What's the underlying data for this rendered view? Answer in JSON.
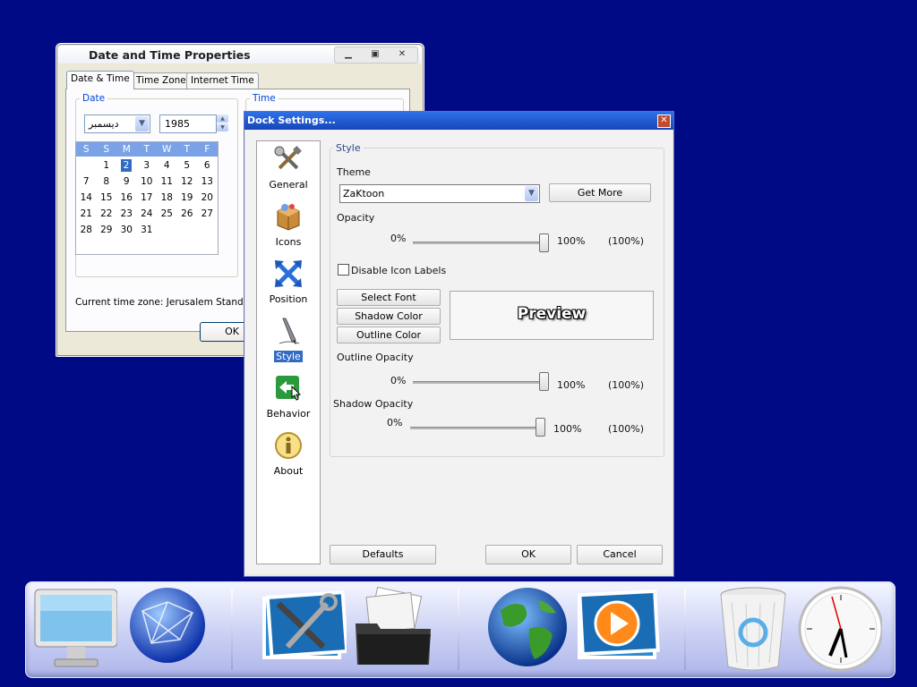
{
  "date_time_window": {
    "title": "Date and Time Properties",
    "controls": {
      "minimize": "▁",
      "maximize": "▣",
      "close": "✕"
    },
    "tabs": [
      "Date & Time",
      "Time Zone",
      "Internet Time"
    ],
    "date_group_label": "Date",
    "time_group_label": "Time",
    "month_value": "دیسمبر",
    "year_value": "1985",
    "calendar": {
      "day_headers": [
        "S",
        "S",
        "M",
        "T",
        "W",
        "T",
        "F"
      ],
      "weeks": [
        [
          "",
          "",
          "1",
          "2",
          "3",
          "4",
          "5",
          "6"
        ],
        [
          "7",
          "8",
          "9",
          "10",
          "11",
          "12",
          "13"
        ],
        [
          "14",
          "15",
          "16",
          "17",
          "18",
          "19",
          "20"
        ],
        [
          "21",
          "22",
          "23",
          "24",
          "25",
          "26",
          "27"
        ],
        [
          "28",
          "29",
          "30",
          "31",
          "",
          "",
          ""
        ]
      ],
      "selected_day": "2"
    },
    "timezone_text": "Current time zone:  Jerusalem Standard",
    "ok_label": "OK"
  },
  "dock_settings": {
    "title": "Dock Settings...",
    "close_glyph": "✕",
    "sidebar": [
      {
        "label": "General",
        "icon": "tools-icon"
      },
      {
        "label": "Icons",
        "icon": "box-icon"
      },
      {
        "label": "Position",
        "icon": "arrows-icon"
      },
      {
        "label": "Style",
        "icon": "pen-icon",
        "selected": true
      },
      {
        "label": "Behavior",
        "icon": "behavior-icon"
      },
      {
        "label": "About",
        "icon": "info-icon"
      }
    ],
    "style_group_label": "Style",
    "theme_label": "Theme",
    "theme_value": "ZaKtoon",
    "get_more_label": "Get More",
    "opacity_label": "Opacity",
    "opacity_min": "0%",
    "opacity_max": "100%",
    "opacity_value": "(100%)",
    "disable_labels_text": "Disable Icon Labels",
    "disable_labels_checked": false,
    "select_font_label": "Select Font",
    "shadow_color_label": "Shadow Color",
    "outline_color_label": "Outline Color",
    "preview_text": "Preview",
    "outline_opacity_label": "Outline Opacity",
    "outline_min": "0%",
    "outline_max": "100%",
    "outline_value": "(100%)",
    "shadow_opacity_label": "Shadow Opacity",
    "shadow_min": "0%",
    "shadow_max": "100%",
    "shadow_value": "(100%)",
    "defaults_label": "Defaults",
    "ok_label": "OK",
    "cancel_label": "Cancel"
  },
  "dock": {
    "items": [
      "monitor-icon",
      "network-globe-icon",
      "tools-icon",
      "folder-icon",
      "earth-icon",
      "media-player-icon",
      "recycle-bin-icon",
      "clock-icon"
    ]
  },
  "colors": {
    "desktop": "#000a84",
    "title_blue": "#1f5bd0",
    "selection": "#316ac5"
  }
}
